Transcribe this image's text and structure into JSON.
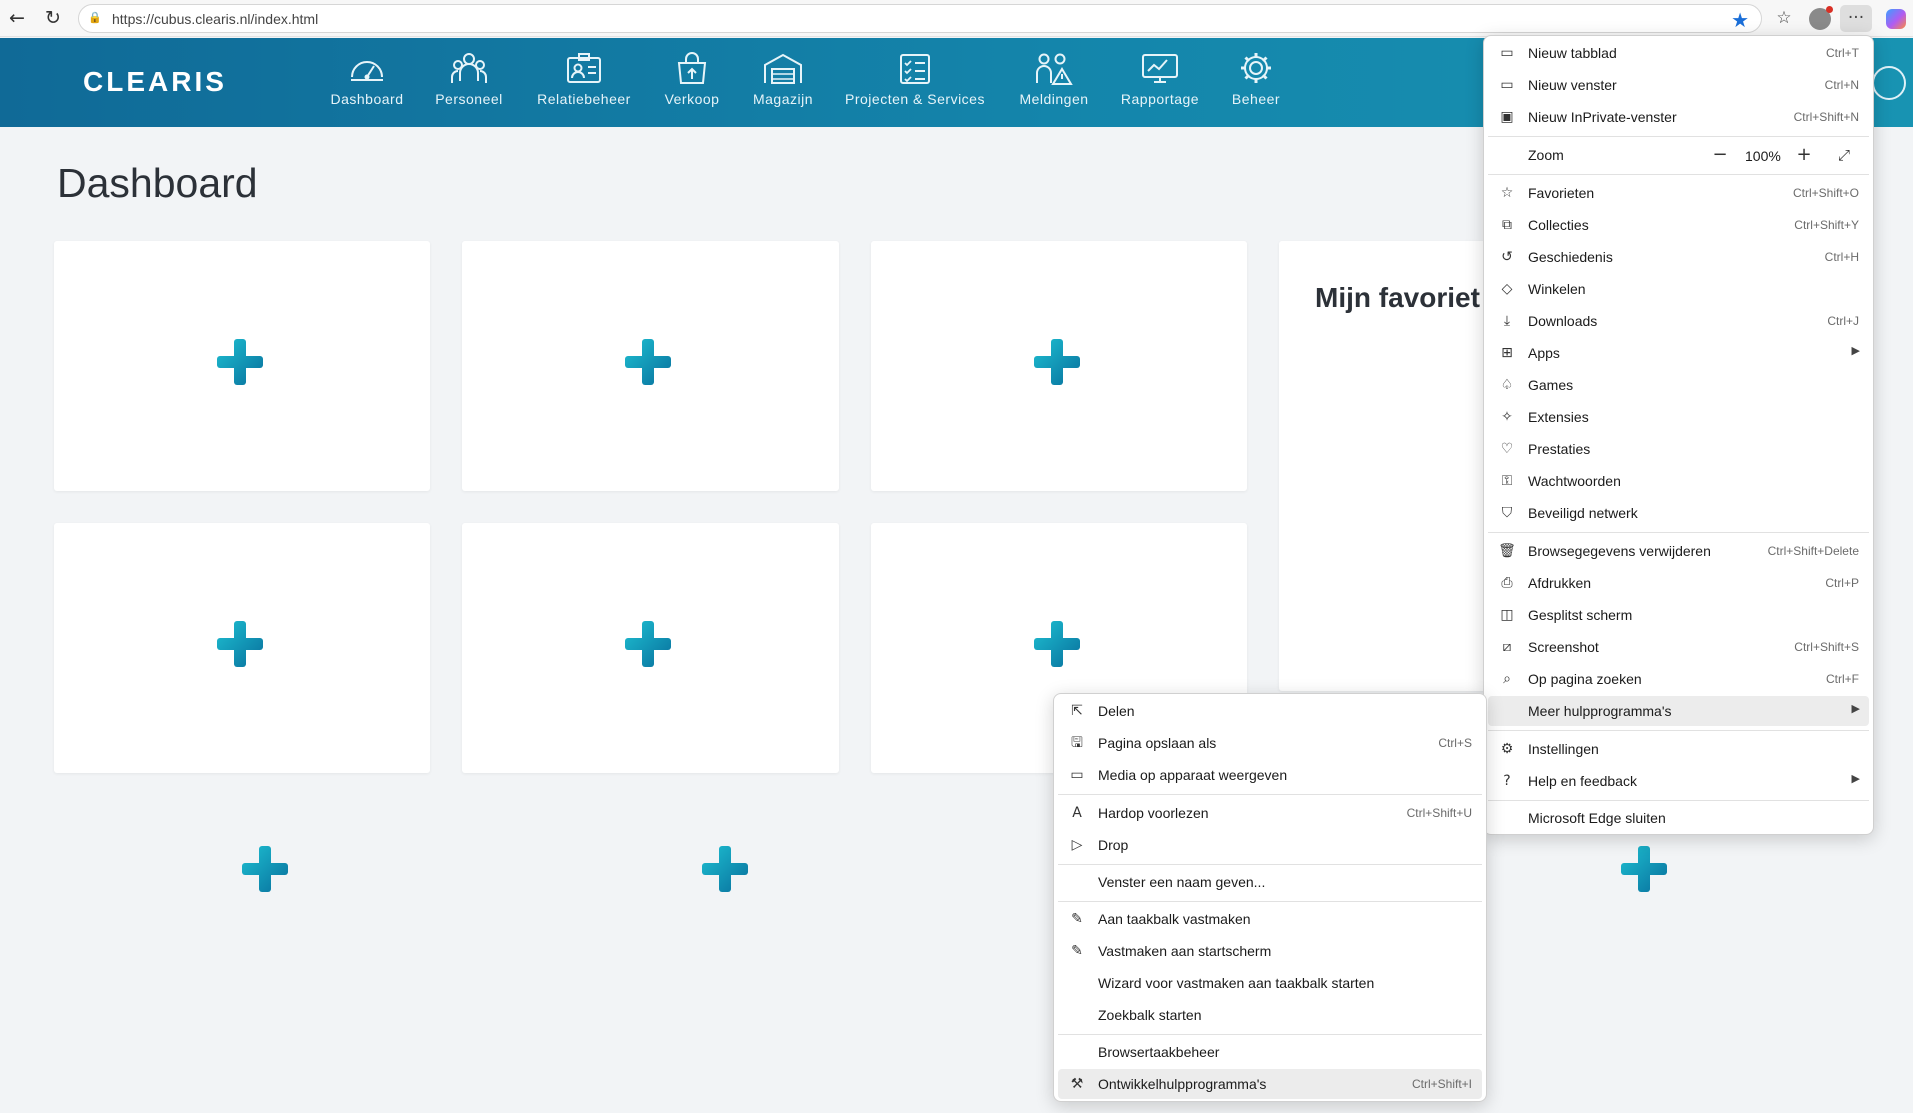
{
  "browser": {
    "url": "https://cubus.clearis.nl/index.html"
  },
  "app": {
    "logo": "CLEARIS",
    "nav": [
      {
        "label": "Dashboard",
        "icon": "speedometer-icon"
      },
      {
        "label": "Personeel",
        "icon": "people-icon"
      },
      {
        "label": "Relatiebeheer",
        "icon": "contact-card-icon"
      },
      {
        "label": "Verkoop",
        "icon": "shopping-bag-icon"
      },
      {
        "label": "Magazijn",
        "icon": "warehouse-icon"
      },
      {
        "label": "Projecten & Services",
        "icon": "clipboard-icon"
      },
      {
        "label": "Meldingen",
        "icon": "alert-people-icon"
      },
      {
        "label": "Rapportage",
        "icon": "report-screen-icon"
      },
      {
        "label": "Beheer",
        "icon": "gear-icon"
      }
    ]
  },
  "page": {
    "title": "Dashboard",
    "favorites_title": "Mijn favoriet"
  },
  "edge_menu": {
    "items": [
      {
        "label": "Nieuw tabblad",
        "shortcut": "Ctrl+T",
        "icon": "new-tab-icon"
      },
      {
        "label": "Nieuw venster",
        "shortcut": "Ctrl+N",
        "icon": "new-window-icon"
      },
      {
        "label": "Nieuw InPrivate-venster",
        "shortcut": "Ctrl+Shift+N",
        "icon": "inprivate-icon"
      },
      {
        "label": "Favorieten",
        "shortcut": "Ctrl+Shift+O",
        "icon": "favorites-icon"
      },
      {
        "label": "Collecties",
        "shortcut": "Ctrl+Shift+Y",
        "icon": "collections-icon"
      },
      {
        "label": "Geschiedenis",
        "shortcut": "Ctrl+H",
        "icon": "history-icon"
      },
      {
        "label": "Winkelen",
        "shortcut": "",
        "icon": "shopping-tag-icon"
      },
      {
        "label": "Downloads",
        "shortcut": "Ctrl+J",
        "icon": "download-icon"
      },
      {
        "label": "Apps",
        "shortcut": "",
        "icon": "apps-icon"
      },
      {
        "label": "Games",
        "shortcut": "",
        "icon": "games-icon"
      },
      {
        "label": "Extensies",
        "shortcut": "",
        "icon": "extensions-icon"
      },
      {
        "label": "Prestaties",
        "shortcut": "",
        "icon": "performance-icon"
      },
      {
        "label": "Wachtwoorden",
        "shortcut": "",
        "icon": "key-icon"
      },
      {
        "label": "Beveiligd netwerk",
        "shortcut": "",
        "icon": "shield-icon"
      },
      {
        "label": "Browsegegevens verwijderen",
        "shortcut": "Ctrl+Shift+Delete",
        "icon": "trash-icon"
      },
      {
        "label": "Afdrukken",
        "shortcut": "Ctrl+P",
        "icon": "print-icon"
      },
      {
        "label": "Gesplitst scherm",
        "shortcut": "",
        "icon": "split-screen-icon"
      },
      {
        "label": "Screenshot",
        "shortcut": "Ctrl+Shift+S",
        "icon": "screenshot-icon"
      },
      {
        "label": "Op pagina zoeken",
        "shortcut": "Ctrl+F",
        "icon": "find-icon"
      },
      {
        "label": "Meer hulpprogramma's",
        "shortcut": "",
        "icon": ""
      },
      {
        "label": "Instellingen",
        "shortcut": "",
        "icon": "gear-icon"
      },
      {
        "label": "Help en feedback",
        "shortcut": "",
        "icon": "help-icon"
      },
      {
        "label": "Microsoft Edge sluiten",
        "shortcut": "",
        "icon": ""
      }
    ],
    "zoom_label": "Zoom",
    "zoom_value": "100%"
  },
  "tools_menu": {
    "items": [
      {
        "label": "Delen",
        "shortcut": "",
        "icon": "share-icon"
      },
      {
        "label": "Pagina opslaan als",
        "shortcut": "Ctrl+S",
        "icon": "save-page-icon"
      },
      {
        "label": "Media op apparaat weergeven",
        "shortcut": "",
        "icon": "cast-icon"
      },
      {
        "label": "Hardop voorlezen",
        "shortcut": "Ctrl+Shift+U",
        "icon": "read-aloud-icon"
      },
      {
        "label": "Drop",
        "shortcut": "",
        "icon": "send-icon"
      },
      {
        "label": "Venster een naam geven...",
        "shortcut": "",
        "icon": ""
      },
      {
        "label": "Aan taakbalk vastmaken",
        "shortcut": "",
        "icon": "pin-icon"
      },
      {
        "label": "Vastmaken aan startscherm",
        "shortcut": "",
        "icon": "pin-icon"
      },
      {
        "label": "Wizard voor vastmaken aan taakbalk starten",
        "shortcut": "",
        "icon": ""
      },
      {
        "label": "Zoekbalk starten",
        "shortcut": "",
        "icon": ""
      },
      {
        "label": "Browsertaakbeheer",
        "shortcut": "",
        "icon": ""
      },
      {
        "label": "Ontwikkelhulpprogramma's",
        "shortcut": "Ctrl+Shift+I",
        "icon": "devtools-icon"
      }
    ]
  },
  "colors": {
    "header_start": "#106a97",
    "header_end": "#1893b2",
    "plus_accent": "#0c7ea6",
    "page_bg": "#f2f4f6"
  }
}
